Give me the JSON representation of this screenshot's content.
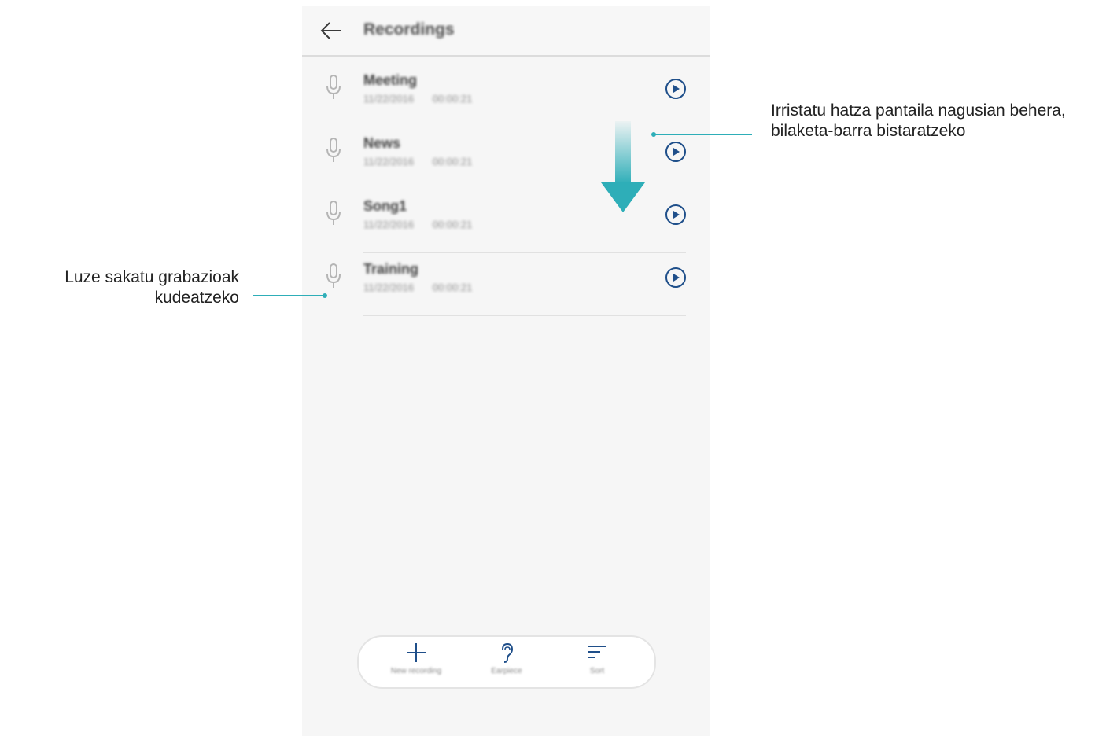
{
  "app": {
    "title": "Recordings"
  },
  "recordings": [
    {
      "name": "Meeting",
      "meta": "11/22/2016 00:00:21"
    },
    {
      "name": "News",
      "meta": "11/22/2016 00:00:21"
    },
    {
      "name": "Song1",
      "meta": "11/22/2016 00:00:21"
    },
    {
      "name": "Training",
      "meta": "11/22/2016 00:00:21"
    }
  ],
  "bottom_bar": {
    "new_label": "New recording",
    "earpiece_label": "Earpiece",
    "sort_label": "Sort"
  },
  "annotations": {
    "swipe": "Irristatu hatza pantaila nagusian behera, bilaketa-barra bistaratzeko",
    "longpress": "Luze sakatu grabazioak kudeatzeko"
  },
  "colors": {
    "accent": "#2eaeb8",
    "icon_blue": "#1f4f8a",
    "mic_gray": "#b5b5b5"
  },
  "icons": {
    "back": "arrow-left-icon",
    "mic": "microphone-icon",
    "play": "play-circle-icon",
    "add": "plus-icon",
    "earpiece": "ear-icon",
    "sort": "sort-icon"
  }
}
